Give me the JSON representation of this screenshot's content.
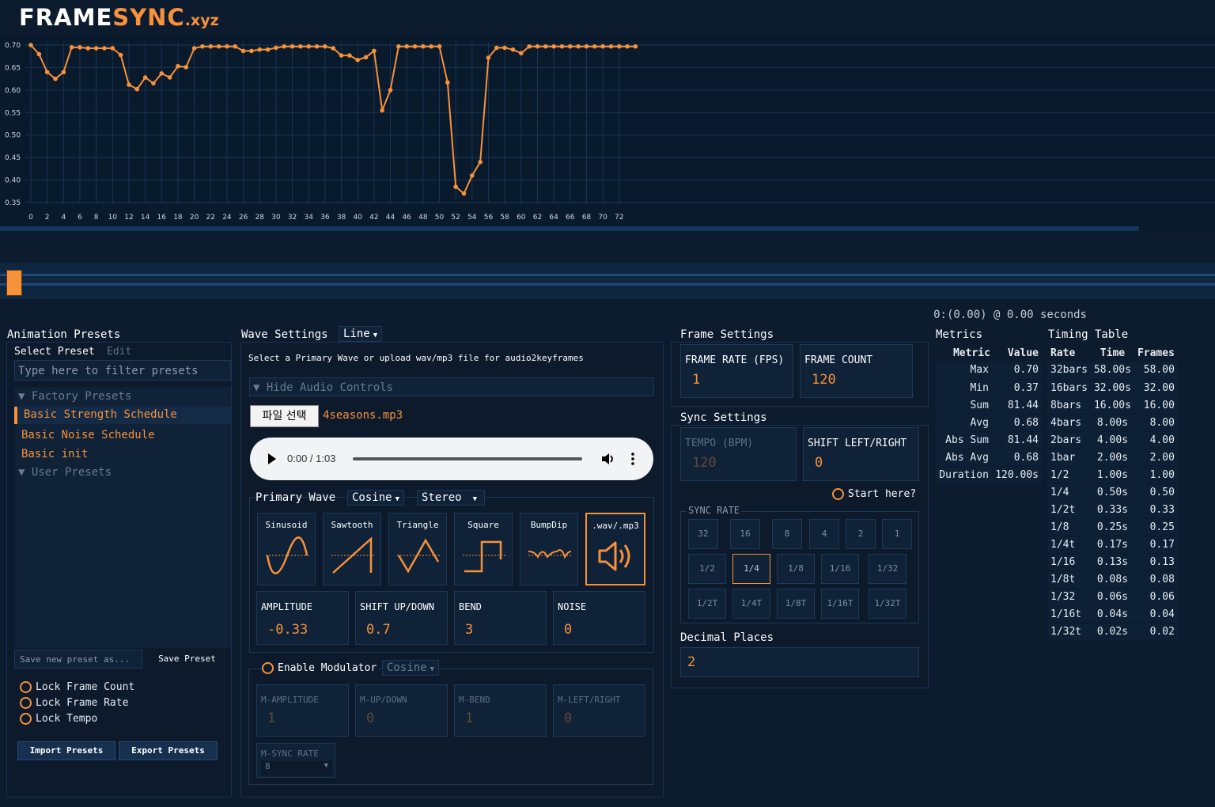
{
  "brand": {
    "part1": "FRAME",
    "part2": "SYNC",
    "part3": ".xyz"
  },
  "chart_data": {
    "type": "line",
    "x": [
      0,
      1,
      2,
      3,
      4,
      5,
      6,
      7,
      8,
      9,
      10,
      11,
      12,
      13,
      14,
      15,
      16,
      17,
      18,
      19,
      20,
      21,
      22,
      23,
      24,
      25,
      26,
      27,
      28,
      29,
      30,
      31,
      32,
      33,
      34,
      35,
      36,
      37,
      38,
      39,
      40,
      41,
      42,
      43,
      44,
      45,
      46,
      47,
      48,
      49,
      50,
      51,
      52,
      53,
      54,
      55,
      56,
      57,
      58,
      59,
      60,
      61,
      62,
      63,
      64,
      65,
      66,
      67,
      68,
      69,
      70,
      71,
      72,
      73,
      74
    ],
    "values": [
      0.7,
      0.68,
      0.64,
      0.625,
      0.64,
      0.695,
      0.695,
      0.693,
      0.693,
      0.693,
      0.693,
      0.678,
      0.612,
      0.602,
      0.628,
      0.615,
      0.637,
      0.628,
      0.653,
      0.651,
      0.693,
      0.697,
      0.697,
      0.697,
      0.697,
      0.697,
      0.687,
      0.687,
      0.69,
      0.69,
      0.694,
      0.697,
      0.697,
      0.697,
      0.697,
      0.697,
      0.697,
      0.693,
      0.677,
      0.677,
      0.667,
      0.673,
      0.687,
      0.555,
      0.6,
      0.697,
      0.697,
      0.697,
      0.697,
      0.697,
      0.697,
      0.617,
      0.385,
      0.37,
      0.41,
      0.44,
      0.672,
      0.694,
      0.694,
      0.69,
      0.682,
      0.697,
      0.697,
      0.697,
      0.697,
      0.697,
      0.697,
      0.697,
      0.697,
      0.697,
      0.697,
      0.697,
      0.697,
      0.697,
      0.697
    ],
    "ylim": [
      0.35,
      0.7
    ],
    "yticks": [
      "0.70",
      "0.65",
      "0.60",
      "0.55",
      "0.50",
      "0.45",
      "0.40",
      "0.35"
    ],
    "xticks": [
      "0",
      "2",
      "4",
      "6",
      "8",
      "10",
      "12",
      "14",
      "16",
      "18",
      "20",
      "22",
      "24",
      "26",
      "28",
      "30",
      "32",
      "34",
      "36",
      "38",
      "40",
      "42",
      "44",
      "46",
      "48",
      "50",
      "52",
      "54",
      "56",
      "58",
      "60",
      "62",
      "64",
      "66",
      "68",
      "70",
      "72"
    ],
    "color": "#f7913a",
    "grid": true
  },
  "playback": {
    "readout": "0:(0.00) @ 0.00 seconds"
  },
  "presets": {
    "title": "Animation Presets",
    "tab_select": "Select Preset",
    "tab_edit": "Edit",
    "filter_placeholder": "Type here to filter presets",
    "factory_group": "▼ Factory Presets",
    "factory_items": [
      "Basic Strength Schedule",
      "Basic Noise Schedule",
      "Basic init"
    ],
    "user_group": "▼ User Presets",
    "save_placeholder": "Save new preset as...",
    "save_button": "Save Preset",
    "lock_frame_count": "Lock Frame Count",
    "lock_frame_rate": "Lock Frame Rate",
    "lock_tempo": "Lock Tempo",
    "import_button": "Import Presets",
    "export_button": "Export Presets"
  },
  "wave": {
    "title": "Wave Settings",
    "mode": "Line",
    "instruction": "Select a Primary Wave or upload wav/mp3 file for audio2keyframes",
    "audio_toggle": "▼ Hide Audio Controls",
    "file_button": "파일 선택",
    "file_name": "4seasons.mp3",
    "audio_time": "0:00 / 1:03",
    "primary_label": "Primary Wave",
    "primary_type": "Cosine",
    "channel": "Stereo",
    "cards": [
      "Sinusoid",
      "Sawtooth",
      "Triangle",
      "Square",
      "BumpDip",
      ".wav/.mp3"
    ],
    "params": [
      {
        "label": "AMPLITUDE",
        "value": "-0.33"
      },
      {
        "label": "SHIFT UP/DOWN",
        "value": "0.7"
      },
      {
        "label": "BEND",
        "value": "3"
      },
      {
        "label": "NOISE",
        "value": "0"
      }
    ],
    "modulator_label": "Enable Modulator",
    "modulator_type": "Cosine",
    "mod_params": [
      {
        "label": "M-AMPLITUDE",
        "value": "1"
      },
      {
        "label": "M-UP/DOWN",
        "value": "0"
      },
      {
        "label": "M-BEND",
        "value": "1"
      },
      {
        "label": "M-LEFT/RIGHT",
        "value": "0"
      }
    ],
    "msync_label": "M-SYNC RATE",
    "msync_value": "8"
  },
  "frame": {
    "title": "Frame Settings",
    "rate_label": "FRAME RATE (FPS)",
    "rate_value": "1",
    "count_label": "FRAME COUNT",
    "count_value": "120"
  },
  "sync": {
    "title": "Sync Settings",
    "tempo_label": "TEMPO (BPM)",
    "tempo_value": "120",
    "shift_label": "SHIFT LEFT/RIGHT",
    "shift_value": "0",
    "start_here": "Start here?",
    "rate_title": "SYNC RATE",
    "rates_row1": [
      "32",
      "16",
      "8",
      "4",
      "2",
      "1"
    ],
    "rates_row2": [
      "1/2",
      "1/4",
      "1/8",
      "1/16",
      "1/32"
    ],
    "rates_row3": [
      "1/2T",
      "1/4T",
      "1/8T",
      "1/16T",
      "1/32T"
    ],
    "active_rate": "1/4"
  },
  "decimal": {
    "title": "Decimal Places",
    "value": "2"
  },
  "metrics": {
    "title": "Metrics",
    "headers": [
      "Metric",
      "Value"
    ],
    "rows": [
      [
        "Max",
        "0.70"
      ],
      [
        "Min",
        "0.37"
      ],
      [
        "Sum",
        "81.44"
      ],
      [
        "Avg",
        "0.68"
      ],
      [
        "Abs Sum",
        "81.44"
      ],
      [
        "Abs Avg",
        "0.68"
      ],
      [
        "Duration",
        "120.00s"
      ]
    ]
  },
  "timing": {
    "title": "Timing Table",
    "headers": [
      "Rate",
      "Time",
      "Frames"
    ],
    "rows": [
      [
        "32bars",
        "58.00s",
        "58.00"
      ],
      [
        "16bars",
        "32.00s",
        "32.00"
      ],
      [
        "8bars",
        "16.00s",
        "16.00"
      ],
      [
        "4bars",
        "8.00s",
        "8.00"
      ],
      [
        "2bars",
        "4.00s",
        "4.00"
      ],
      [
        "1bar",
        "2.00s",
        "2.00"
      ],
      [
        "1/2",
        "1.00s",
        "1.00"
      ],
      [
        "1/4",
        "0.50s",
        "0.50"
      ],
      [
        "1/2t",
        "0.33s",
        "0.33"
      ],
      [
        "1/8",
        "0.25s",
        "0.25"
      ],
      [
        "1/4t",
        "0.17s",
        "0.17"
      ],
      [
        "1/16",
        "0.13s",
        "0.13"
      ],
      [
        "1/8t",
        "0.08s",
        "0.08"
      ],
      [
        "1/32",
        "0.06s",
        "0.06"
      ],
      [
        "1/16t",
        "0.04s",
        "0.04"
      ],
      [
        "1/32t",
        "0.02s",
        "0.02"
      ]
    ]
  }
}
